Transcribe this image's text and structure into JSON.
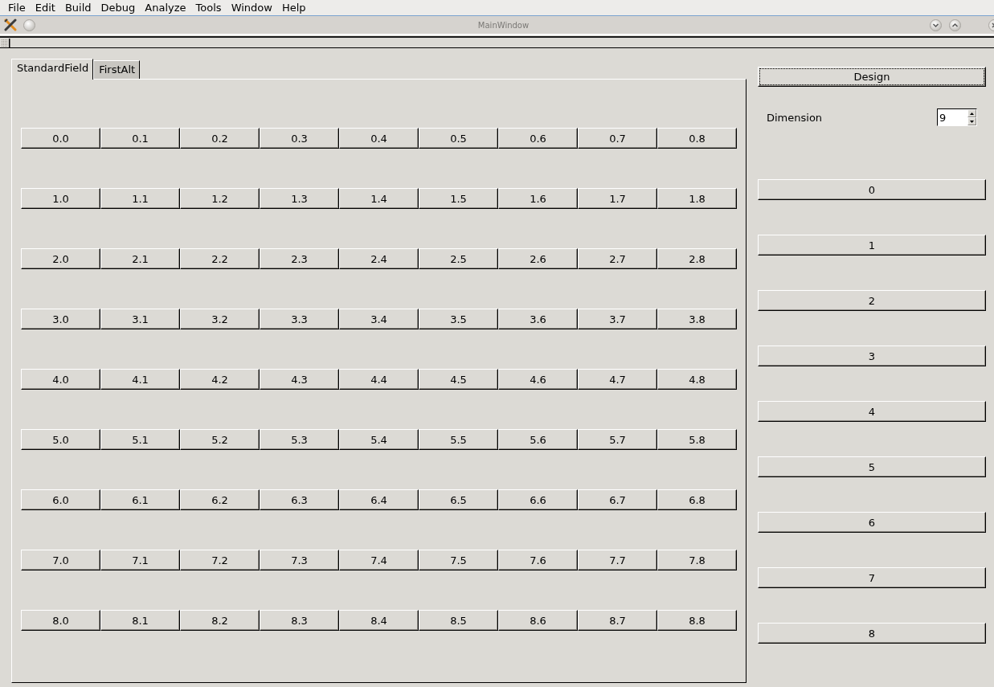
{
  "menu_bar": {
    "items": [
      "File",
      "Edit",
      "Build",
      "Debug",
      "Analyze",
      "Tools",
      "Window",
      "Help"
    ]
  },
  "window": {
    "title": "MainWindow"
  },
  "tabs": [
    {
      "label": "StandardField",
      "selected": true
    },
    {
      "label": "FirstAlt",
      "selected": false
    }
  ],
  "field_grid": {
    "rows": [
      [
        "0.0",
        "0.1",
        "0.2",
        "0.3",
        "0.4",
        "0.5",
        "0.6",
        "0.7",
        "0.8"
      ],
      [
        "1.0",
        "1.1",
        "1.2",
        "1.3",
        "1.4",
        "1.5",
        "1.6",
        "1.7",
        "1.8"
      ],
      [
        "2.0",
        "2.1",
        "2.2",
        "2.3",
        "2.4",
        "2.5",
        "2.6",
        "2.7",
        "2.8"
      ],
      [
        "3.0",
        "3.1",
        "3.2",
        "3.3",
        "3.4",
        "3.5",
        "3.6",
        "3.7",
        "3.8"
      ],
      [
        "4.0",
        "4.1",
        "4.2",
        "4.3",
        "4.4",
        "4.5",
        "4.6",
        "4.7",
        "4.8"
      ],
      [
        "5.0",
        "5.1",
        "5.2",
        "5.3",
        "5.4",
        "5.5",
        "5.6",
        "5.7",
        "5.8"
      ],
      [
        "6.0",
        "6.1",
        "6.2",
        "6.3",
        "6.4",
        "6.5",
        "6.6",
        "6.7",
        "6.8"
      ],
      [
        "7.0",
        "7.1",
        "7.2",
        "7.3",
        "7.4",
        "7.5",
        "7.6",
        "7.7",
        "7.8"
      ],
      [
        "8.0",
        "8.1",
        "8.2",
        "8.3",
        "8.4",
        "8.5",
        "8.6",
        "8.7",
        "8.8"
      ]
    ]
  },
  "side_panel": {
    "design_button": {
      "label": "Design",
      "focused": true
    },
    "dimension": {
      "label": "Dimension",
      "value": "9"
    },
    "buttons": [
      "0",
      "1",
      "2",
      "3",
      "4",
      "5",
      "6",
      "7",
      "8"
    ]
  }
}
